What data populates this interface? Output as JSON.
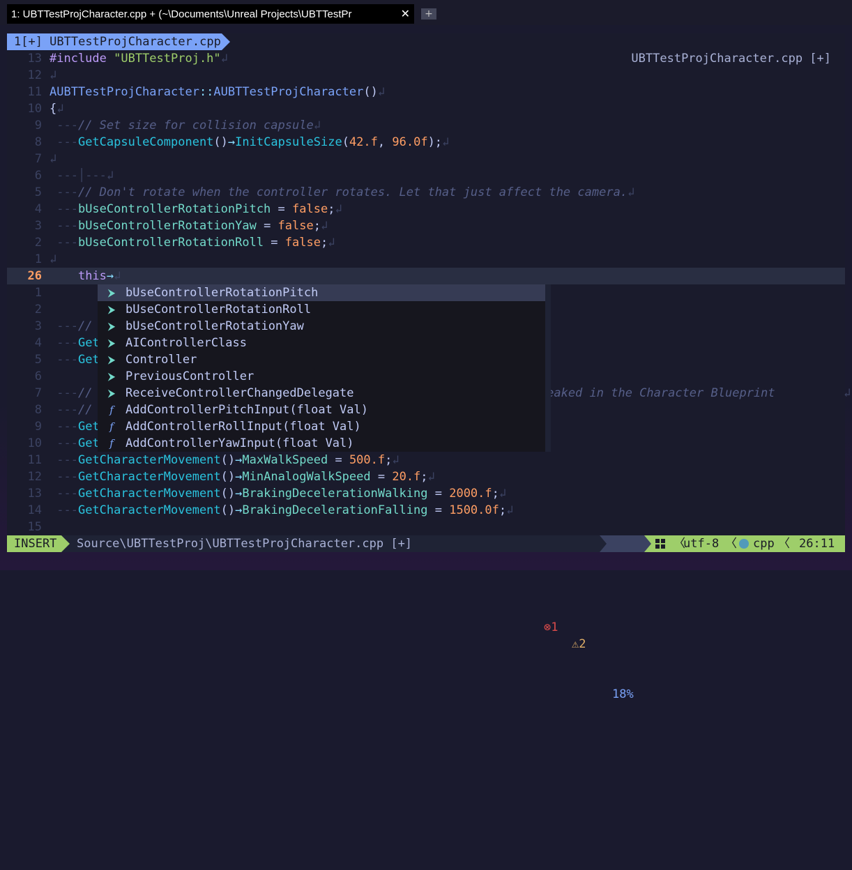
{
  "tab": {
    "title": "1: UBTTestProjCharacter.cpp + (~\\Documents\\Unreal Projects\\UBTTestPr",
    "close": "✕",
    "new": "+"
  },
  "bufferline": {
    "label": "1[+] UBTTestProjCharacter.cpp"
  },
  "winbar": {
    "label": "UBTTestProjCharacter.cpp [+]"
  },
  "editor": {
    "eol": "↲",
    "lead": "---",
    "lines": [
      {
        "n": "13",
        "t": [
          "#include ",
          "\"UBTTestProj.h\""
        ]
      },
      {
        "n": "12",
        "t": []
      },
      {
        "n": "11",
        "t": [
          "AUBTTestProjCharacter",
          "::",
          "AUBTTestProjCharacter",
          "()"
        ]
      },
      {
        "n": "10",
        "t": [
          "{"
        ]
      },
      {
        "n": "9",
        "t": [
          "// Set size for collision capsule"
        ]
      },
      {
        "n": "8",
        "t": [
          "GetCapsuleComponent",
          "()",
          "→",
          "InitCapsuleSize",
          "(",
          "42.f",
          ", ",
          "96.0f",
          ");"
        ]
      },
      {
        "n": "7",
        "t": []
      },
      {
        "n": "6",
        "t": [
          "│---"
        ]
      },
      {
        "n": "5",
        "t": [
          "// Don't rotate when the controller rotates. Let that just affect the camera."
        ]
      },
      {
        "n": "4",
        "t": [
          "bUseControllerRotationPitch",
          " = ",
          "false",
          ";"
        ]
      },
      {
        "n": "3",
        "t": [
          "bUseControllerRotationYaw",
          " = ",
          "false",
          ";"
        ]
      },
      {
        "n": "2",
        "t": [
          "bUseControllerRotationRoll",
          " = ",
          "false",
          ";"
        ]
      },
      {
        "n": "1",
        "t": []
      },
      {
        "n": "26",
        "t": [
          "this",
          "→"
        ]
      },
      {
        "n": "1",
        "t": []
      },
      {
        "n": "2",
        "t": []
      },
      {
        "n": "3",
        "t": [
          "//"
        ]
      },
      {
        "n": "4",
        "t": [
          "Get"
        ]
      },
      {
        "n": "5",
        "t": [
          "Get",
          ";"
        ]
      },
      {
        "n": "6",
        "t": []
      },
      {
        "n": "7",
        "t": [
          "//",
          "can be tweaked in the Character Blueprint"
        ]
      },
      {
        "n": "8",
        "t": [
          "//"
        ]
      },
      {
        "n": "9",
        "t": [
          "Get"
        ]
      },
      {
        "n": "10",
        "t": [
          "Get"
        ]
      },
      {
        "n": "11",
        "t": [
          "GetCharacterMovement",
          "()",
          "→",
          "MaxWalkSpeed",
          " = ",
          "500.f",
          ";"
        ]
      },
      {
        "n": "12",
        "t": [
          "GetCharacterMovement",
          "()",
          "→",
          "MinAnalogWalkSpeed",
          " = ",
          "20.f",
          ";"
        ]
      },
      {
        "n": "13",
        "t": [
          "GetCharacterMovement",
          "()",
          "→",
          "BrakingDecelerationWalking",
          " = ",
          "2000.f",
          ";"
        ]
      },
      {
        "n": "14",
        "t": [
          "GetCharacterMovement",
          "()",
          "→",
          "BrakingDecelerationFalling",
          " = ",
          "1500.0f",
          ";"
        ]
      },
      {
        "n": "15",
        "t": []
      }
    ]
  },
  "completion": {
    "items": [
      {
        "icon": "field-icon",
        "glyph": "⮞",
        "label": "bUseControllerRotationPitch"
      },
      {
        "icon": "field-icon",
        "glyph": "⮞",
        "label": "bUseControllerRotationRoll"
      },
      {
        "icon": "field-icon",
        "glyph": "⮞",
        "label": "bUseControllerRotationYaw"
      },
      {
        "icon": "field-icon",
        "glyph": "⮞",
        "label": "AIControllerClass"
      },
      {
        "icon": "field-icon",
        "glyph": "⮞",
        "label": "Controller"
      },
      {
        "icon": "field-icon",
        "glyph": "⮞",
        "label": "PreviousController"
      },
      {
        "icon": "field-icon",
        "glyph": "⮞",
        "label": "ReceiveControllerChangedDelegate"
      },
      {
        "icon": "function-icon",
        "glyph": "f",
        "label": "AddControllerPitchInput(float Val)"
      },
      {
        "icon": "function-icon",
        "glyph": "f",
        "label": "AddControllerRollInput(float Val)"
      },
      {
        "icon": "function-icon",
        "glyph": "f",
        "label": "AddControllerYawInput(float Val)"
      }
    ]
  },
  "status": {
    "mode": "INSERT",
    "path": "Source\\UBTTestProj\\UBTTestProjCharacter.cpp [+]",
    "errors": "1",
    "warnings": "2",
    "error_glyph": "⊗",
    "warning_glyph": "⚠",
    "percent": "18%",
    "encoding": "utf-8",
    "filetype": "cpp",
    "position": "26:11"
  },
  "colors": {
    "accent": "#7aa2f7",
    "mode": "#9ece6a",
    "error": "#db4b4b",
    "warning": "#e0af68"
  }
}
